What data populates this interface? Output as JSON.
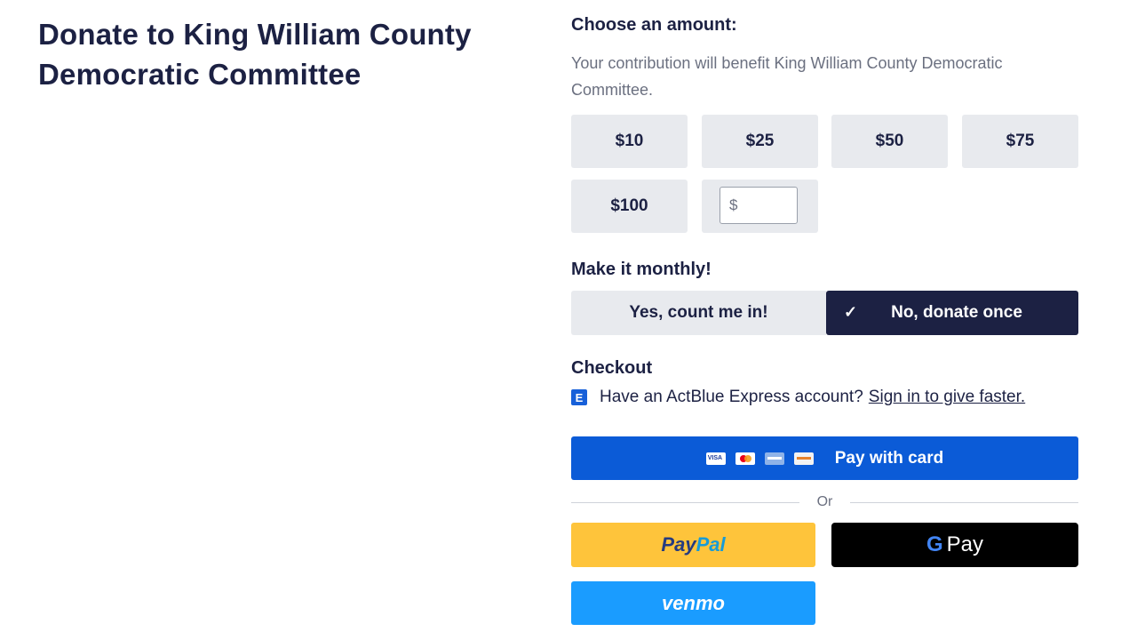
{
  "page": {
    "title": "Donate to King William County Democratic Committee"
  },
  "amount": {
    "heading": "Choose an amount:",
    "description": "Your contribution will benefit King William County Democratic Committee.",
    "options": [
      "$10",
      "$25",
      "$50",
      "$75",
      "$100"
    ],
    "custom_placeholder": "$"
  },
  "monthly": {
    "heading": "Make it monthly!",
    "yes_label": "Yes, count me in!",
    "no_label": "No, donate once",
    "selected": "no"
  },
  "checkout": {
    "heading": "Checkout",
    "express_prompt": "Have an ActBlue Express account?",
    "express_link": "Sign in to give faster.",
    "pay_card_label": "Pay with card",
    "card_icons": [
      "visa-icon",
      "mastercard-icon",
      "amex-icon",
      "discover-icon"
    ],
    "or_label": "Or",
    "paypal_part1": "Pay",
    "paypal_part2": "Pal",
    "gpay_g": "G",
    "gpay_label": "Pay",
    "venmo_label": "venmo"
  },
  "colors": {
    "navy": "#1c2143",
    "card_button": "#0b5bd7",
    "paypal": "#fec43b",
    "venmo": "#1a9cff",
    "amount_bg": "#e8eaee"
  }
}
